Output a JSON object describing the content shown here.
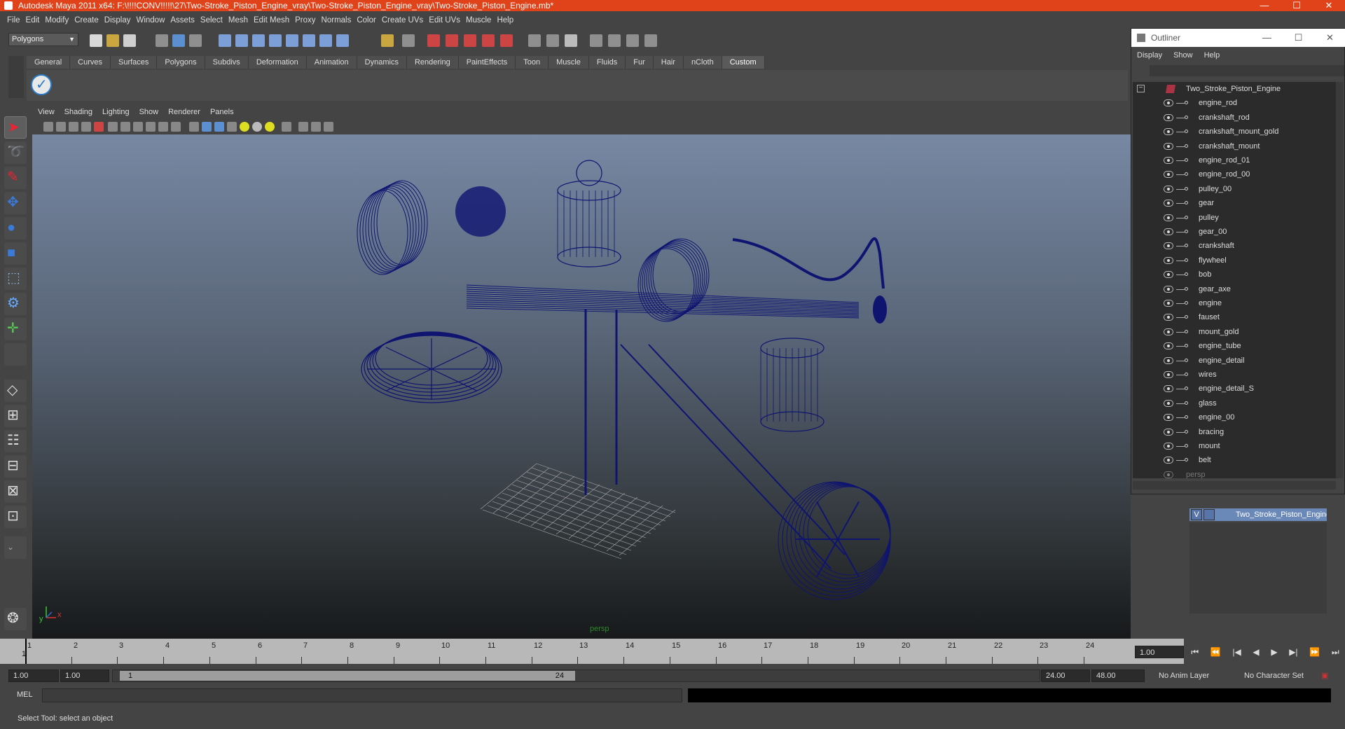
{
  "window": {
    "title": "Autodesk Maya 2011 x64: F:\\!!!!CONV!!!!!\\27\\Two-Stroke_Piston_Engine_vray\\Two-Stroke_Piston_Engine_vray\\Two-Stroke_Piston_Engine.mb*",
    "minimize": "—",
    "maximize": "☐",
    "close": "✕"
  },
  "menubar": [
    "File",
    "Edit",
    "Modify",
    "Create",
    "Display",
    "Window",
    "Assets",
    "Select",
    "Mesh",
    "Edit Mesh",
    "Proxy",
    "Normals",
    "Color",
    "Create UVs",
    "Edit UVs",
    "Muscle",
    "Help"
  ],
  "mode_select": "Polygons",
  "shelf_tabs": [
    "General",
    "Curves",
    "Surfaces",
    "Polygons",
    "Subdivs",
    "Deformation",
    "Animation",
    "Dynamics",
    "Rendering",
    "PaintEffects",
    "Toon",
    "Muscle",
    "Fluids",
    "Fur",
    "Hair",
    "nCloth",
    "Custom"
  ],
  "shelf_active_tab": "Custom",
  "panel_menus": [
    "View",
    "Shading",
    "Lighting",
    "Show",
    "Renderer",
    "Panels"
  ],
  "viewport": {
    "camera_label": "persp",
    "axis_x": "x",
    "axis_y": "y",
    "wire_color": "#0f1470"
  },
  "timeline": {
    "ticks": [
      "1",
      "2",
      "3",
      "4",
      "5",
      "6",
      "7",
      "8",
      "9",
      "10",
      "11",
      "12",
      "13",
      "14",
      "15",
      "16",
      "17",
      "18",
      "19",
      "20",
      "21",
      "22",
      "23",
      "24"
    ],
    "current_frame": "1",
    "current_time_field": "1.00"
  },
  "playback_buttons": [
    "⏮",
    "⏪",
    "|◀",
    "◀",
    "▶",
    "▶|",
    "⏩",
    "⏭"
  ],
  "range": {
    "start_time": "1.00",
    "playback_start": "1.00",
    "slider_start": "1",
    "slider_end": "24",
    "playback_end": "24.00",
    "end_time": "48.00",
    "anim_layer": "No Anim Layer",
    "character_set": "No Character Set"
  },
  "cmdline": {
    "label": "MEL"
  },
  "helpline": "Select Tool: select an object",
  "outliner": {
    "title": "Outliner",
    "menus": [
      "Display",
      "Show",
      "Help"
    ],
    "root": "Two_Stroke_Piston_Engine",
    "items": [
      "engine_rod",
      "crankshaft_rod",
      "crankshaft_mount_gold",
      "crankshaft_mount",
      "engine_rod_01",
      "engine_rod_00",
      "pulley_00",
      "gear",
      "pulley",
      "gear_00",
      "crankshaft",
      "flywheel",
      "bob",
      "gear_axe",
      "engine",
      "fauset",
      "mount_gold",
      "engine_tube",
      "engine_detail",
      "wires",
      "engine_detail_S",
      "glass",
      "engine_00",
      "bracing",
      "mount",
      "belt"
    ],
    "camera_item": "persp"
  },
  "layer": {
    "visible_flag": "V",
    "name": "Two_Stroke_Piston_Engine"
  }
}
